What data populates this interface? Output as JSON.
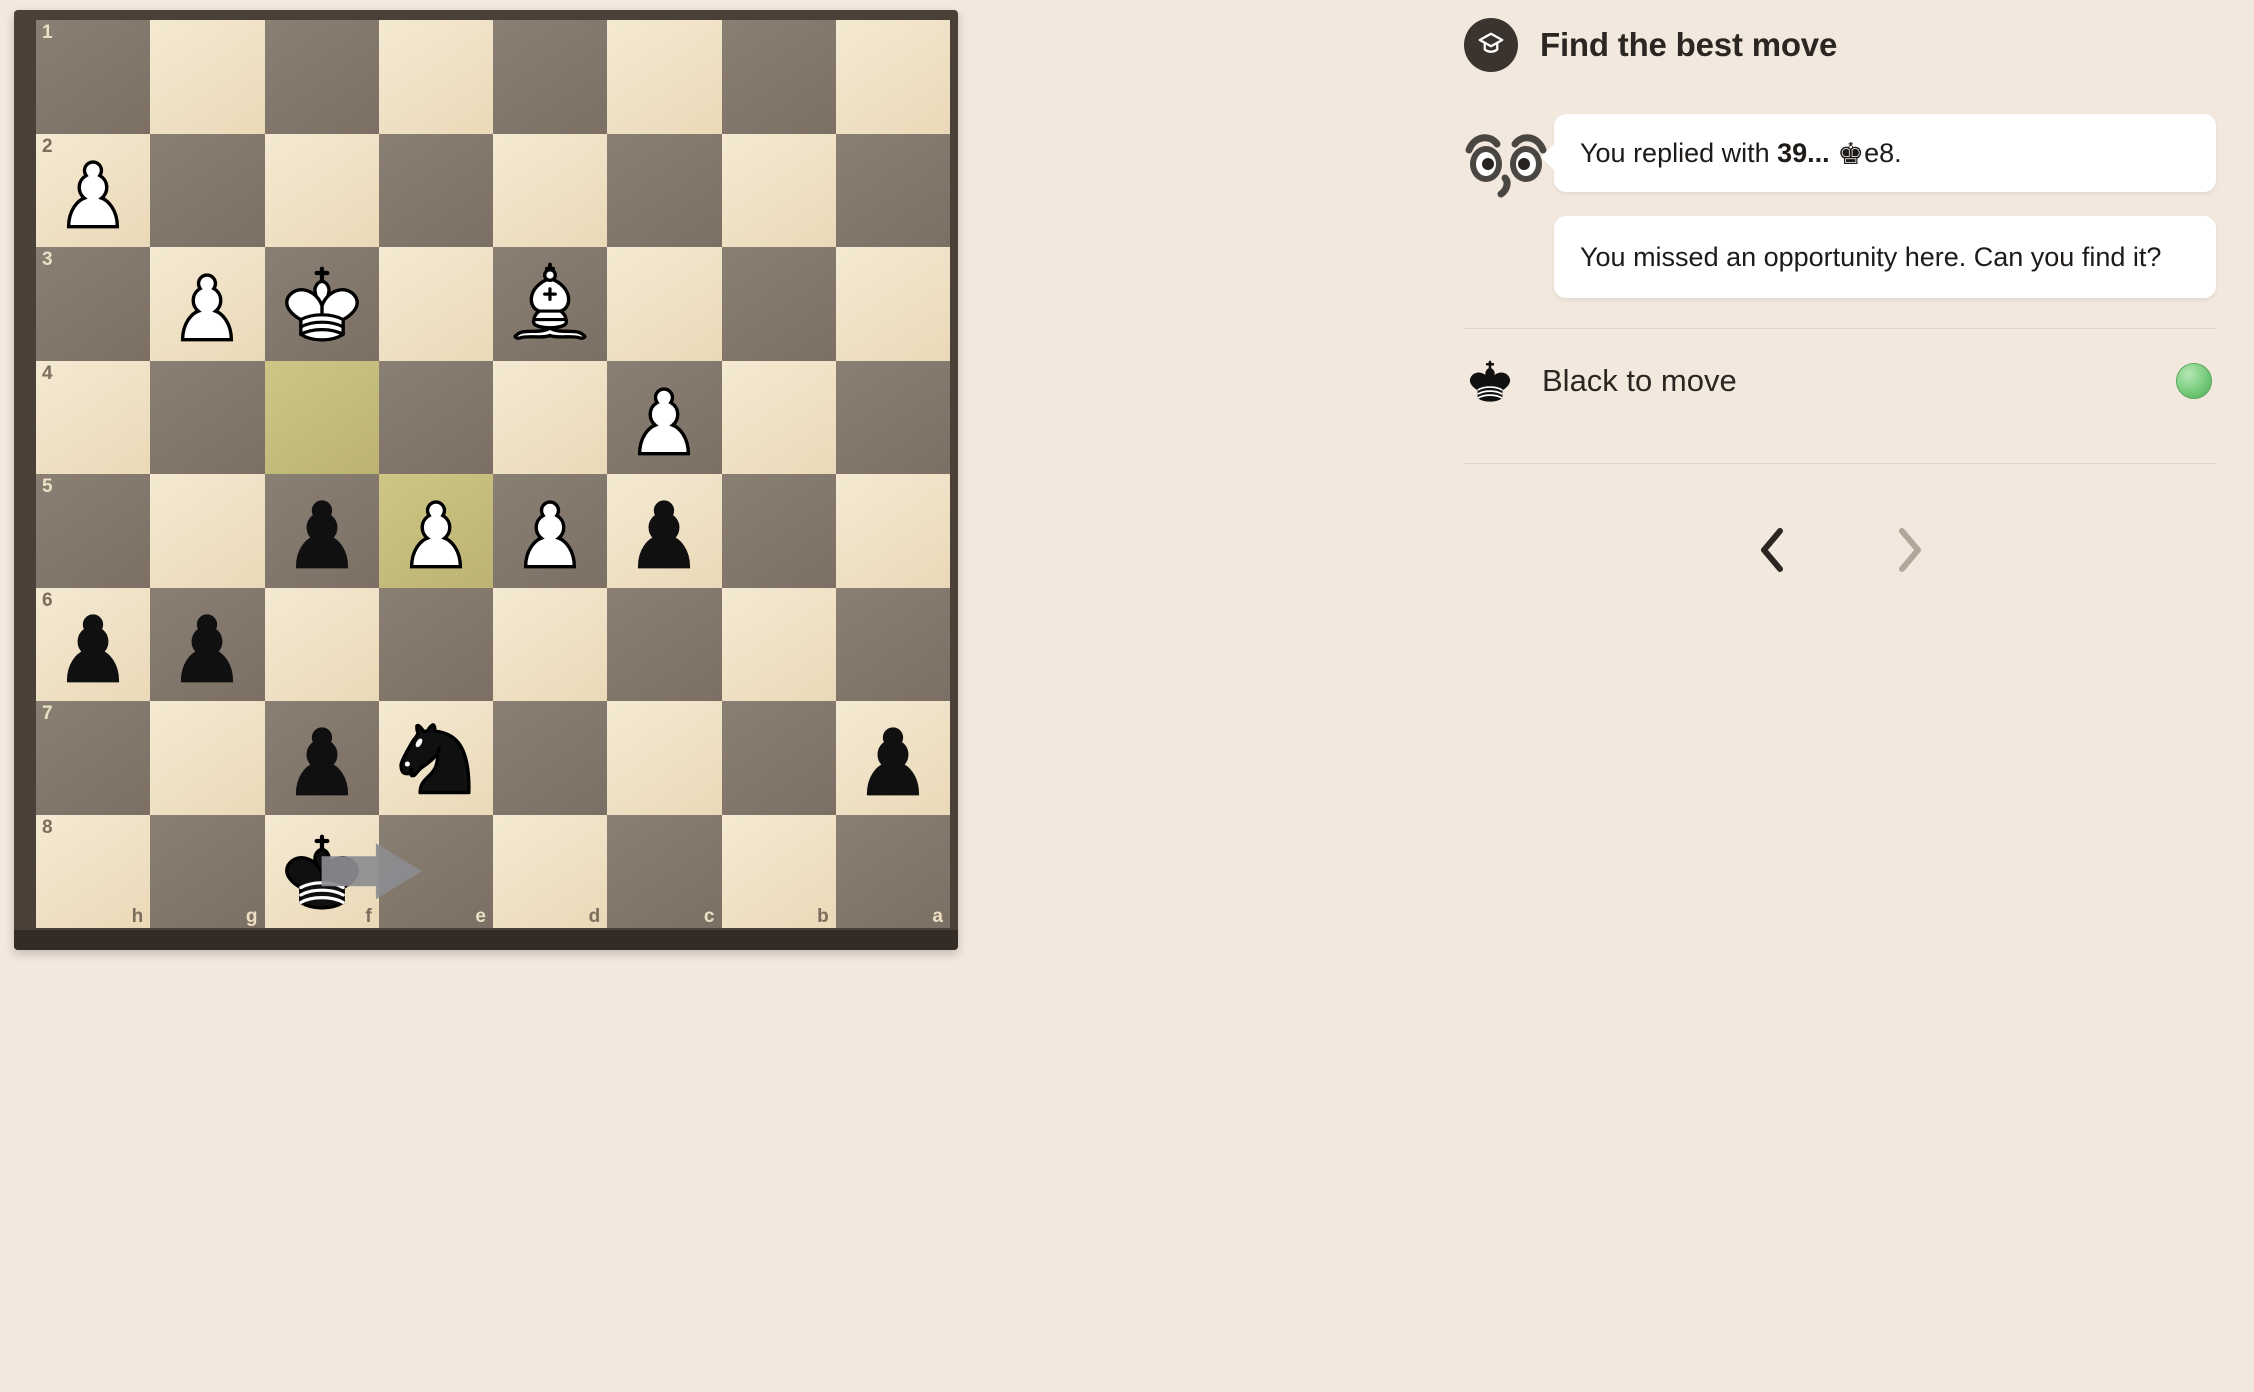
{
  "header": {
    "title": "Find the best move",
    "badge_icon": "graduation-cap-icon"
  },
  "messages": [
    {
      "id": "reply",
      "prefix": "You replied with ",
      "move_number": "39... ",
      "piece_glyph": "♚",
      "move_square": "e8.",
      "full_text": "You replied with 39... ♚e8."
    },
    {
      "id": "hint",
      "full_text": "You missed an opportunity here. Can you find it?"
    }
  ],
  "turn": {
    "label": "Black to move",
    "icon": "black-king-icon",
    "status_color": "#76cb7a"
  },
  "navigation": {
    "prev_label": "‹",
    "next_label": "›",
    "prev_enabled": true,
    "next_enabled": false,
    "prev_color": "#2b2622",
    "next_color": "#b3a79c"
  },
  "board": {
    "orientation": "black",
    "files": [
      "h",
      "g",
      "f",
      "e",
      "d",
      "c",
      "b",
      "a"
    ],
    "ranks": [
      "1",
      "2",
      "3",
      "4",
      "5",
      "6",
      "7",
      "8"
    ],
    "light_square_color": "#f0e3c8",
    "dark_square_color": "#82776c",
    "highlight_color": "#c6c07a",
    "frame_color": "#4a4037",
    "highlighted_squares": [
      "f4",
      "e5"
    ],
    "arrow": {
      "from": "f8",
      "to": "e8",
      "color": "#8c8c90"
    },
    "pieces": [
      {
        "square": "h2",
        "color": "white",
        "type": "pawn"
      },
      {
        "square": "g3",
        "color": "white",
        "type": "pawn"
      },
      {
        "square": "f3",
        "color": "white",
        "type": "king"
      },
      {
        "square": "d3",
        "color": "white",
        "type": "bishop"
      },
      {
        "square": "c4",
        "color": "white",
        "type": "pawn"
      },
      {
        "square": "f5",
        "color": "black",
        "type": "pawn"
      },
      {
        "square": "e5",
        "color": "white",
        "type": "pawn"
      },
      {
        "square": "d5",
        "color": "white",
        "type": "pawn"
      },
      {
        "square": "c5",
        "color": "black",
        "type": "pawn"
      },
      {
        "square": "h6",
        "color": "black",
        "type": "pawn"
      },
      {
        "square": "g6",
        "color": "black",
        "type": "pawn"
      },
      {
        "square": "f7",
        "color": "black",
        "type": "pawn"
      },
      {
        "square": "e7",
        "color": "black",
        "type": "knight"
      },
      {
        "square": "a7",
        "color": "black",
        "type": "pawn"
      },
      {
        "square": "f8",
        "color": "black",
        "type": "king"
      }
    ]
  }
}
